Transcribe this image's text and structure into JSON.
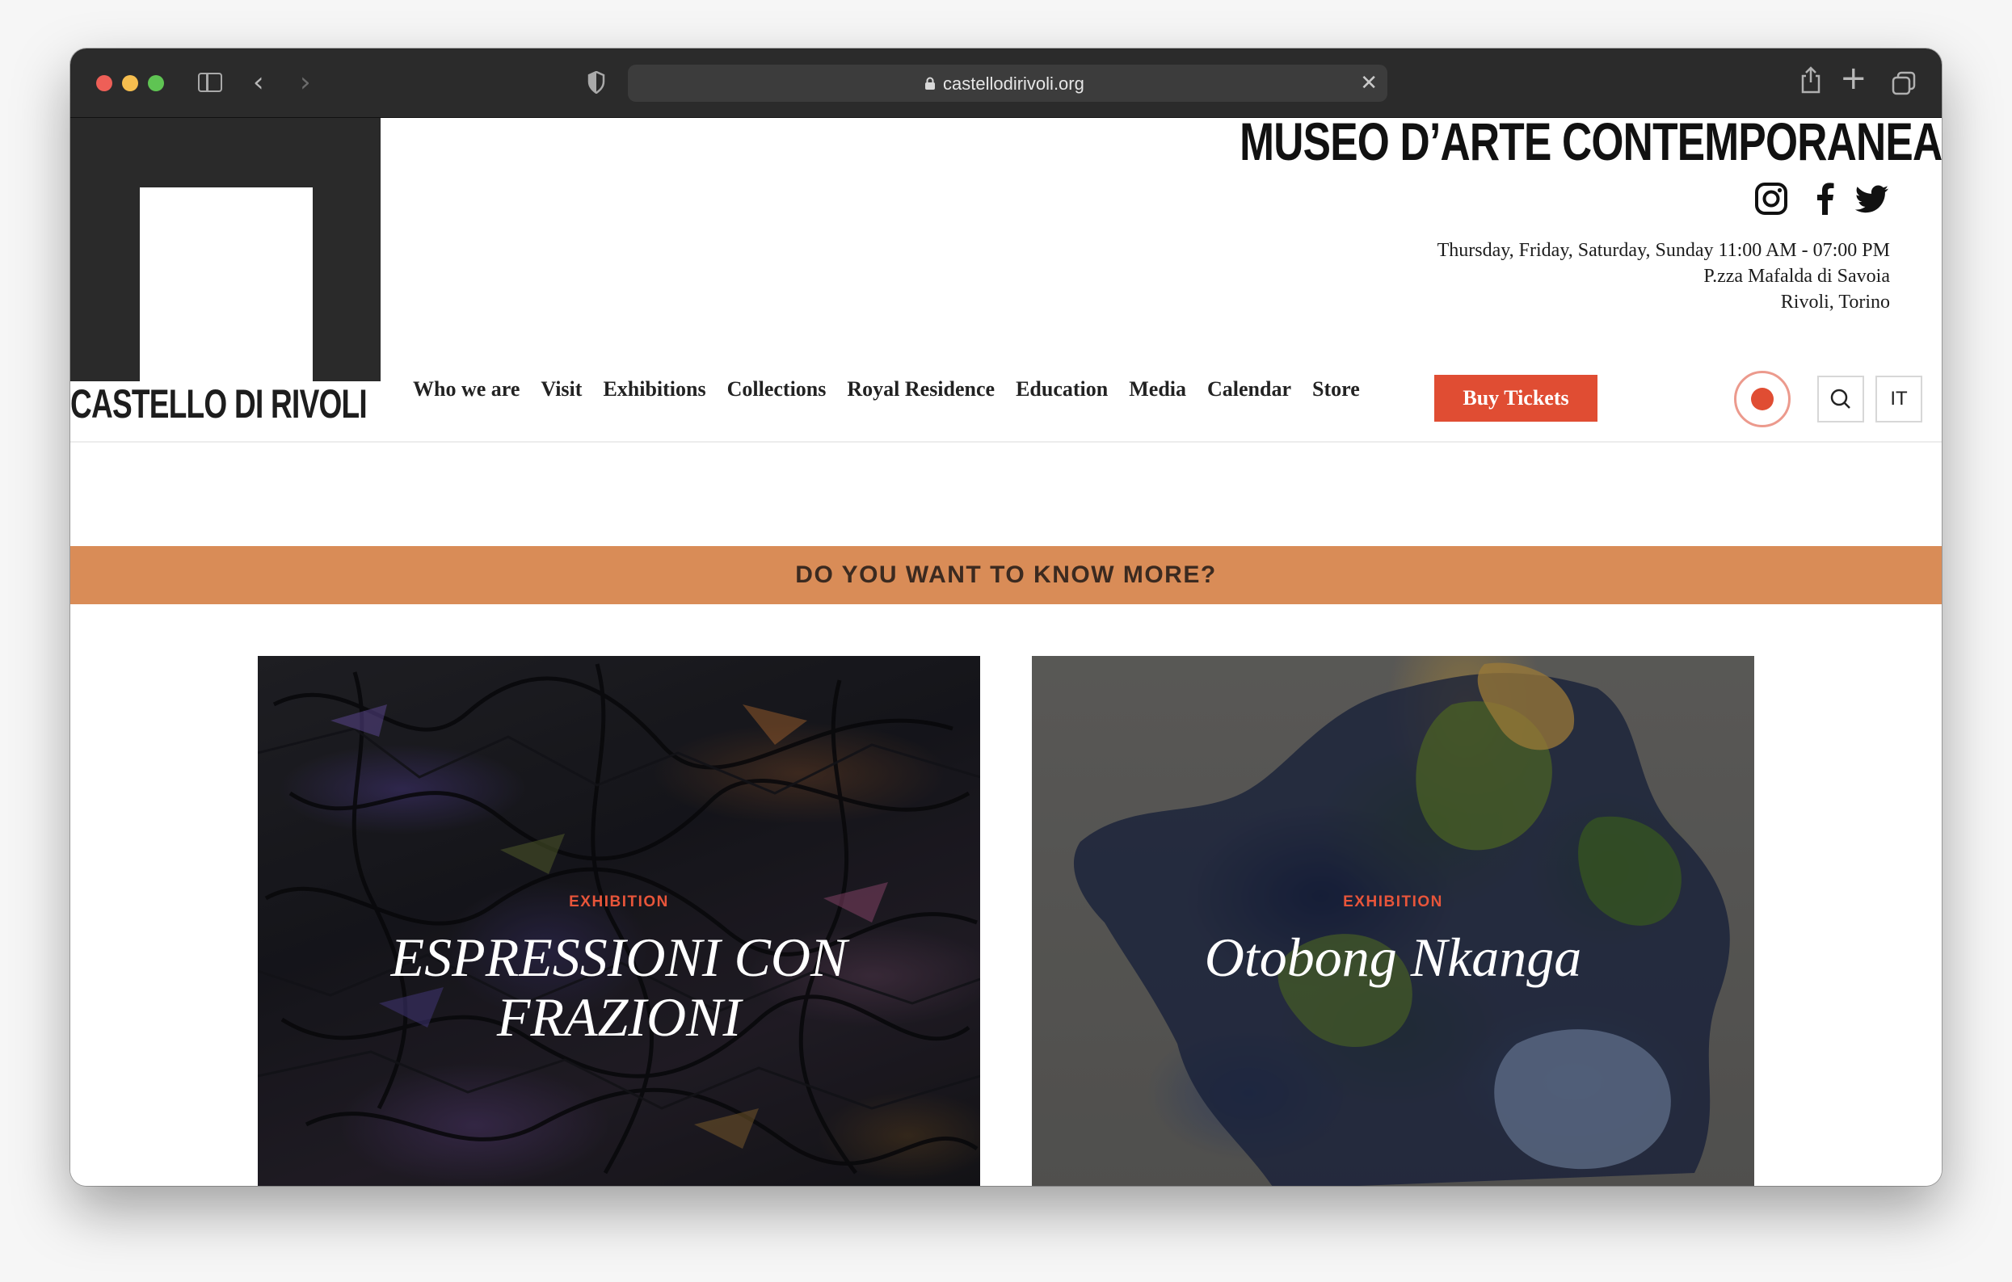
{
  "browser": {
    "url": "castellodirivoli.org"
  },
  "header": {
    "logo_text": "CASTELLO DI RIVOLI",
    "museum_title": "MUSEO D’ARTE CONTEMPORANEA",
    "social": [
      "instagram-icon",
      "facebook-icon",
      "twitter-icon"
    ],
    "hours": "Thursday, Friday, Saturday, Sunday 11:00 AM - 07:00 PM",
    "address_line1": "P.zza Mafalda di Savoia",
    "address_line2": "Rivoli, Torino"
  },
  "nav": {
    "items": [
      {
        "label": "Who we are"
      },
      {
        "label": "Visit"
      },
      {
        "label": "Exhibitions"
      },
      {
        "label": "Collections"
      },
      {
        "label": "Royal Residence"
      },
      {
        "label": "Education"
      },
      {
        "label": "Media"
      },
      {
        "label": "Calendar"
      },
      {
        "label": "Store"
      }
    ],
    "buy_tickets": "Buy Tickets",
    "language": "IT"
  },
  "banner": {
    "text": "DO YOU WANT TO KNOW MORE?"
  },
  "cards": [
    {
      "tag": "EXHIBITION",
      "title": "ESPRESSIONI CON FRAZIONI"
    },
    {
      "tag": "EXHIBITION",
      "title": "Otobong Nkanga"
    }
  ],
  "colors": {
    "accent": "#e04d33",
    "banner": "#d98c57",
    "logo": "#2a2a2a"
  }
}
